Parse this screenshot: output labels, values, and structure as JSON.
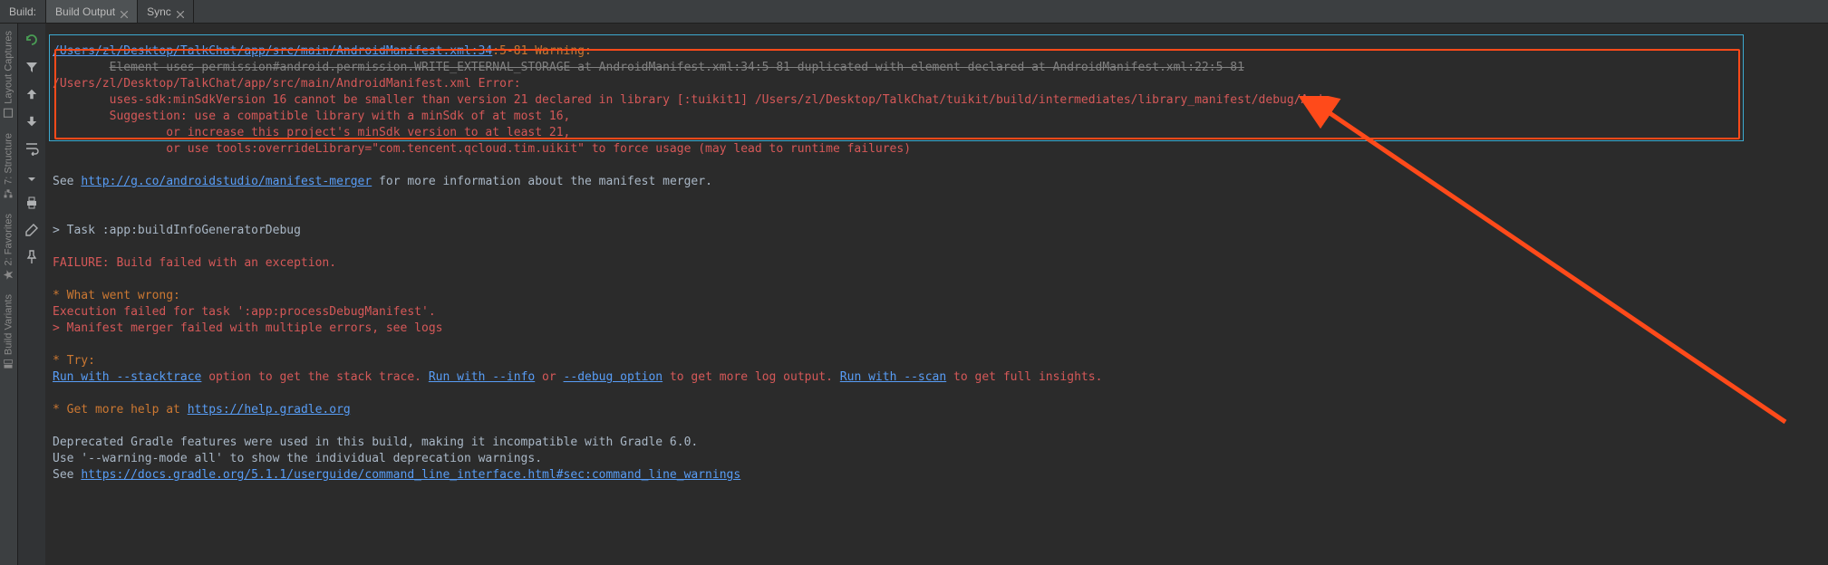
{
  "tabs": {
    "title": "Build:",
    "items": [
      {
        "label": "Build Output",
        "active": true
      },
      {
        "label": "Sync",
        "active": false
      }
    ]
  },
  "side_tools": {
    "layout_captures": "Layout Captures",
    "structure": "7: Structure",
    "favorites": "2: Favorites",
    "build_variants": "Build Variants"
  },
  "console": {
    "line1_link": "/Users/zl/Desktop/TalkChat/app/src/main/AndroidManifest.xml:34",
    "line1_rest": ":5-81 Warning:",
    "line_strike": "\tElement uses-permission#android.permission.WRITE_EXTERNAL_STORAGE at AndroidManifest.xml:34:5-81 duplicated with element declared at AndroidManifest.xml:22:5-81",
    "err1": "/Users/zl/Desktop/TalkChat/app/src/main/AndroidManifest.xml Error:",
    "err2": "\tuses-sdk:minSdkVersion 16 cannot be smaller than version 21 declared in library [:tuikit1] /Users/zl/Desktop/TalkChat/tuikit/build/intermediates/library_manifest/debug/Andr",
    "err3": "\tSuggestion: use a compatible library with a minSdk of at most 16,",
    "err4": "\t\tor increase this project's minSdk version to at least 21,",
    "err5": "\t\tor use tools:overrideLibrary=\"com.tencent.qcloud.tim.uikit\" to force usage (may lead to runtime failures)",
    "see_pre": "See ",
    "see_link": "http://g.co/androidstudio/manifest-merger",
    "see_post": " for more information about the manifest merger.",
    "task": "> Task :app:buildInfoGeneratorDebug",
    "failure": "FAILURE: Build failed with an exception.",
    "wrong_hdr": "* What went wrong:",
    "wrong1": "Execution failed for task ':app:processDebugManifest'.",
    "wrong2": "> Manifest merger failed with multiple errors, see logs",
    "try_hdr": "* Try:",
    "try_l1": "Run with --stacktrace",
    "try_l1b": " option to get the stack trace. ",
    "try_l2": "Run with --info",
    "try_l2b": " or ",
    "try_l3": "--debug option",
    "try_l3b": " to get more log output. ",
    "try_l4": "Run with --scan",
    "try_l4b": " to get full insights.",
    "help_hdr": "* Get more help at ",
    "help_link": "https://help.gradle.org",
    "dep1": "Deprecated Gradle features were used in this build, making it incompatible with Gradle 6.0.",
    "dep2": "Use '--warning-mode all' to show the individual deprecation warnings.",
    "dep3_pre": "See ",
    "dep3_link": "https://docs.gradle.org/5.1.1/userguide/command_line_interface.html#sec:command_line_warnings"
  }
}
